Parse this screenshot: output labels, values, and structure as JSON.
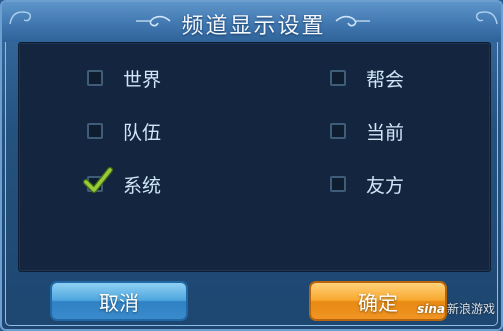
{
  "dialog": {
    "title": "频道显示设置"
  },
  "options": [
    {
      "label": "世界",
      "checked": false
    },
    {
      "label": "帮会",
      "checked": false
    },
    {
      "label": "队伍",
      "checked": false
    },
    {
      "label": "当前",
      "checked": false
    },
    {
      "label": "系统",
      "checked": true
    },
    {
      "label": "友方",
      "checked": false
    }
  ],
  "buttons": {
    "cancel_label": "取消",
    "confirm_label": "确定"
  },
  "watermark": {
    "brand": "sina",
    "text": "新浪游戏"
  },
  "colors": {
    "panel_bg": "#14263f",
    "frame_blue": "#2a5a8e",
    "check_green": "#9ac93a",
    "cancel_blue": "#4ea6de",
    "confirm_orange": "#f7a72e"
  }
}
